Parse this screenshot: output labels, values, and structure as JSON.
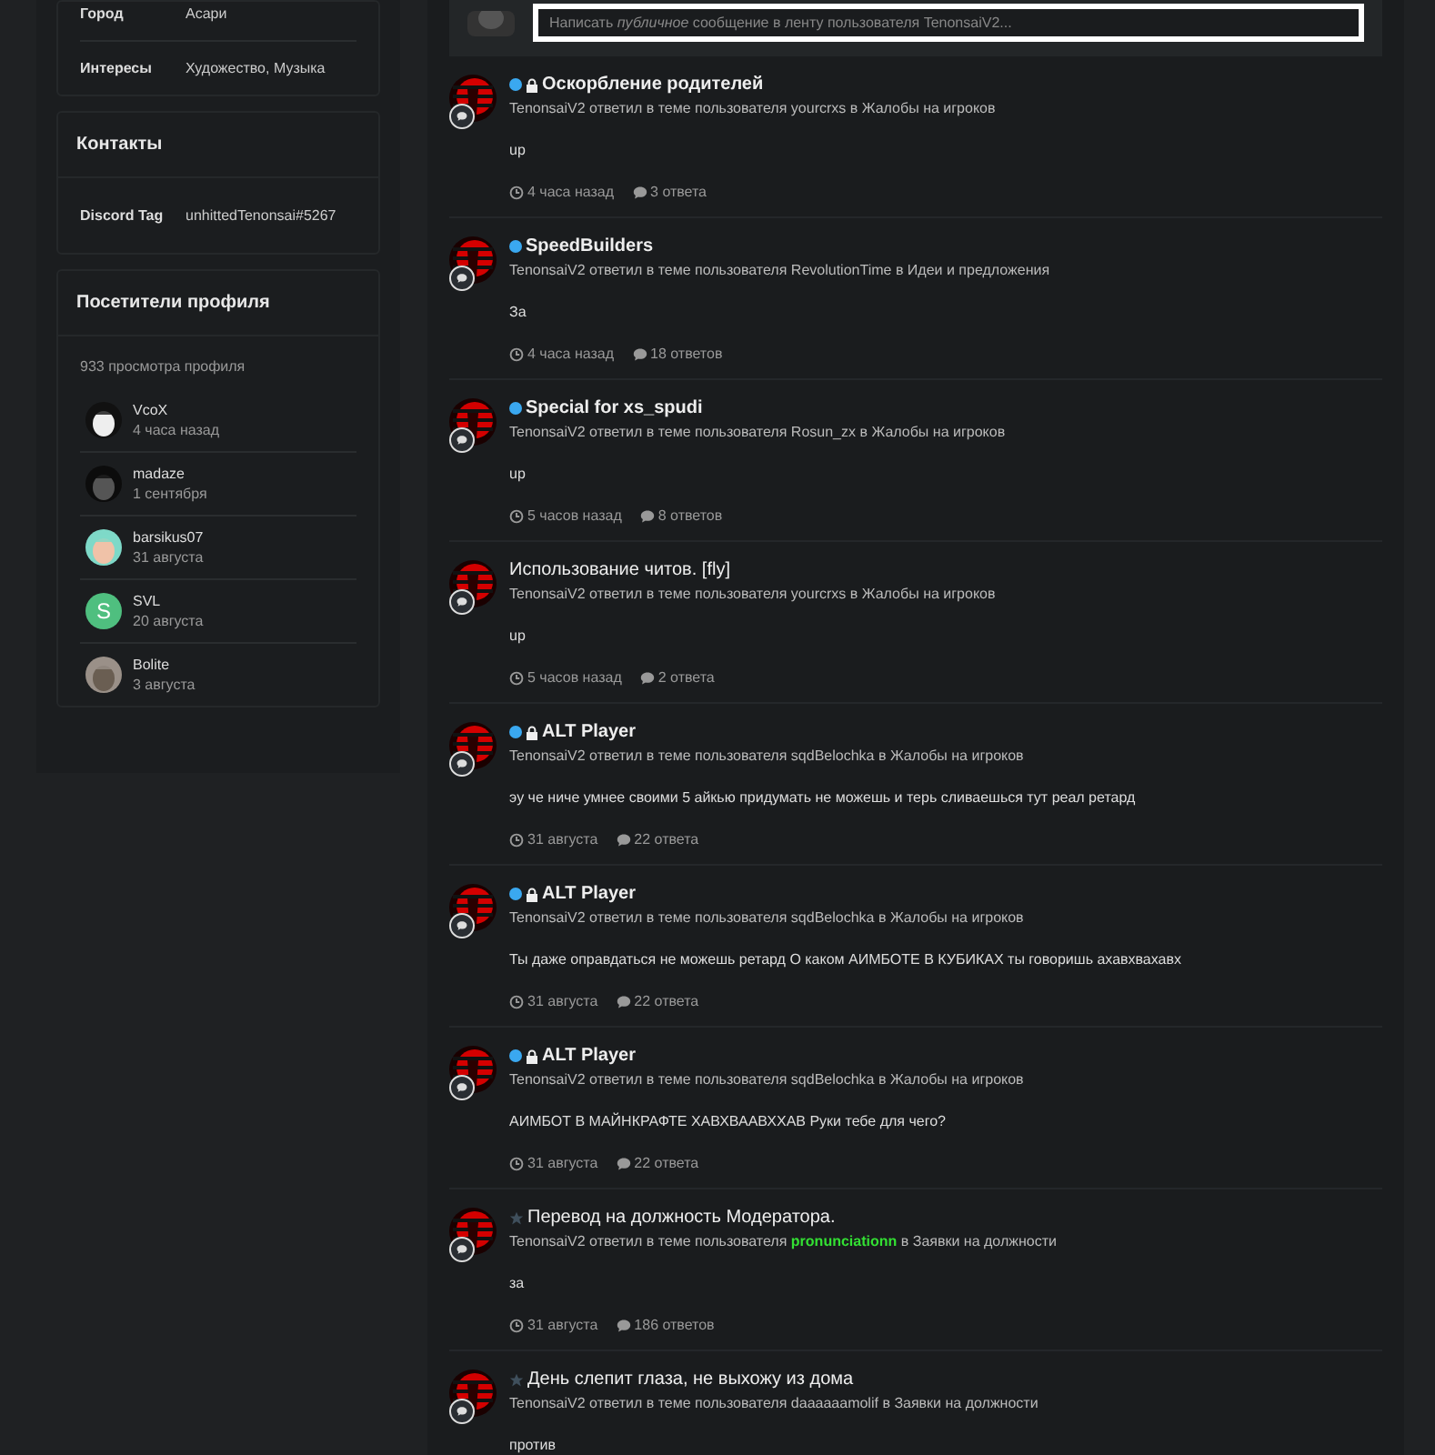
{
  "about": {
    "rows": [
      {
        "label": "Город",
        "value": "Асари"
      },
      {
        "label": "Интересы",
        "value": "Художество, Музыка"
      }
    ]
  },
  "contacts": {
    "title": "Контакты",
    "rows": [
      {
        "label": "Discord Tag",
        "value": "unhittedTenonsai#5267"
      }
    ]
  },
  "visitors": {
    "title": "Посетители профиля",
    "count": "933 просмотра профиля",
    "items": [
      {
        "name": "VcoX",
        "date": "4 часа назад"
      },
      {
        "name": "madaze",
        "date": "1 сентября"
      },
      {
        "name": "barsikus07",
        "date": "31 августа"
      },
      {
        "name": "SVL",
        "date": "20 августа",
        "avatar": {
          "kind": "letter",
          "letter": "S",
          "color": "#4fbf7f"
        }
      },
      {
        "name": "Bolite",
        "date": "3 августа"
      }
    ]
  },
  "composer": {
    "placeholder": "Написать *публичное* сообщение в ленту пользователя TenonsaiV2..."
  },
  "feed": [
    {
      "unread": true,
      "featured": false,
      "locked": true,
      "title": "Оскорбление родителей",
      "actor": "TenonsaiV2",
      "action": "ответил в теме пользователя",
      "user": "yourcrxs",
      "user_highlight": false,
      "forum_prefix": "в",
      "forum": "Жалобы на игроков",
      "excerpt": "up",
      "time": "4 часа назад",
      "replies": "3 ответа"
    },
    {
      "unread": true,
      "featured": false,
      "locked": false,
      "title": "SpeedBuilders",
      "actor": "TenonsaiV2",
      "action": "ответил в теме пользователя",
      "user": "RevolutionTime",
      "user_highlight": false,
      "forum_prefix": "в",
      "forum": "Идеи и предложения",
      "excerpt": "За",
      "time": "4 часа назад",
      "replies": "18 ответов"
    },
    {
      "unread": true,
      "featured": false,
      "locked": false,
      "title": "Special for xs_spudi",
      "actor": "TenonsaiV2",
      "action": "ответил в теме пользователя",
      "user": "Rosun_zx",
      "user_highlight": false,
      "forum_prefix": "в",
      "forum": "Жалобы на игроков",
      "excerpt": "up",
      "time": "5 часов назад",
      "replies": "8 ответов"
    },
    {
      "unread": false,
      "featured": false,
      "locked": false,
      "title": "Использование читов. [fly]",
      "actor": "TenonsaiV2",
      "action": "ответил в теме пользователя",
      "user": "yourcrxs",
      "user_highlight": false,
      "forum_prefix": "в",
      "forum": "Жалобы на игроков",
      "excerpt": "up",
      "time": "5 часов назад",
      "replies": "2 ответа"
    },
    {
      "unread": true,
      "featured": false,
      "locked": true,
      "title": "ALT Player",
      "actor": "TenonsaiV2",
      "action": "ответил в теме пользователя",
      "user": "sqdBelochka",
      "user_highlight": false,
      "forum_prefix": "в",
      "forum": "Жалобы на игроков",
      "excerpt": "эу че ниче умнее своими 5 айкью придумать не можешь и терь сливаешься тут реал ретард",
      "time": "31 августа",
      "replies": "22 ответа"
    },
    {
      "unread": true,
      "featured": false,
      "locked": true,
      "title": "ALT Player",
      "actor": "TenonsaiV2",
      "action": "ответил в теме пользователя",
      "user": "sqdBelochka",
      "user_highlight": false,
      "forum_prefix": "в",
      "forum": "Жалобы на игроков",
      "excerpt": "Ты даже оправдаться не можешь ретард О каком АИМБОТЕ В КУБИКАХ ты говоришь ахавхвахавх",
      "time": "31 августа",
      "replies": "22 ответа"
    },
    {
      "unread": true,
      "featured": false,
      "locked": true,
      "title": "ALT Player",
      "actor": "TenonsaiV2",
      "action": "ответил в теме пользователя",
      "user": "sqdBelochka",
      "user_highlight": false,
      "forum_prefix": "в",
      "forum": "Жалобы на игроков",
      "excerpt": "АИМБОТ В МАЙНКРАФТЕ ХАВХВААВХХАВ Руки тебе для чего?",
      "time": "31 августа",
      "replies": "22 ответа"
    },
    {
      "unread": false,
      "featured": true,
      "locked": false,
      "title": "Перевод на должность Модератора.",
      "actor": "TenonsaiV2",
      "action": "ответил в теме пользователя",
      "user": "pronunciationn",
      "user_highlight": true,
      "forum_prefix": "в",
      "forum": "Заявки на должности",
      "excerpt": "за",
      "time": "31 августа",
      "replies": "186 ответов"
    },
    {
      "unread": false,
      "featured": true,
      "locked": false,
      "title": "День слепит глаза, не выхожу из дома",
      "actor": "TenonsaiV2",
      "action": "ответил в теме пользователя",
      "user": "daaaaaamolif",
      "user_highlight": false,
      "forum_prefix": "в",
      "forum": "Заявки на должности",
      "excerpt": "против"
    }
  ]
}
